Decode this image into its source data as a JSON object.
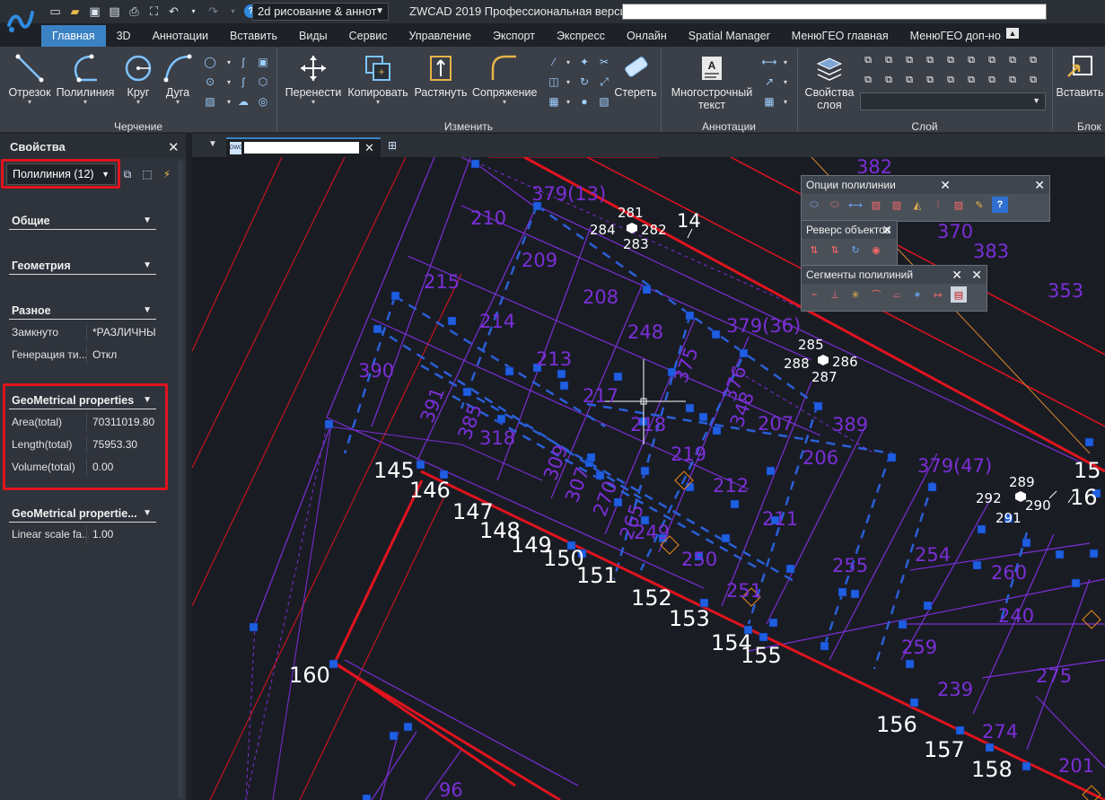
{
  "titlebar": {
    "workspace": "2d рисование & аннот",
    "app_title": "ZWCAD 2019 Профессиональная версия -",
    "qat_icons": [
      "new-icon",
      "open-icon",
      "save-icon",
      "save-as-icon",
      "print-icon",
      "plot-preview-icon",
      "undo-icon",
      "redo-icon",
      "help-icon"
    ]
  },
  "ribbon_tabs": [
    "Главная",
    "3D",
    "Аннотации",
    "Вставить",
    "Виды",
    "Сервис",
    "Управление",
    "Экспорт",
    "Экспресс",
    "Онлайн",
    "Spatial Manager",
    "МенюГЕО главная",
    "МенюГЕО доп-но"
  ],
  "ribbon": {
    "draw": {
      "label": "Черчение",
      "buttons": [
        "Отрезок",
        "Полилиния",
        "Круг",
        "Дуга"
      ]
    },
    "modify": {
      "label": "Изменить",
      "buttons": [
        "Перенести",
        "Копировать",
        "Растянуть",
        "Сопряжение",
        "Стереть"
      ]
    },
    "annotation": {
      "label": "Аннотации",
      "button_line1": "Многострочный",
      "button_line2": "текст"
    },
    "layer": {
      "label": "Слой",
      "button_line1": "Свойства",
      "button_line2": "слоя"
    },
    "block": {
      "label": "Блок",
      "button": "Вставить"
    }
  },
  "properties": {
    "title": "Свойства",
    "object_select": "Полилиния (12)",
    "sections": {
      "general": "Общие",
      "geometry": "Геометрия",
      "misc": "Разное",
      "geom_props": "GeoMetrical properties",
      "geom_props2": "GeoMetrical propertie..."
    },
    "misc_rows": [
      {
        "key": "Замкнуто",
        "value": "*РАЗЛИЧНЫ"
      },
      {
        "key": "Генерация ти...",
        "value": "Откл"
      }
    ],
    "geom_rows": [
      {
        "key": "Area(total)",
        "value": "70311019.80"
      },
      {
        "key": "Length(total)",
        "value": "75953.30"
      },
      {
        "key": "Volume(total)",
        "value": "0.00"
      }
    ],
    "geom2_rows": [
      {
        "key": "Linear scale fa...",
        "value": "1.00"
      }
    ]
  },
  "toolbars": {
    "polyline_options": "Опции полилинии",
    "reverse_objects": "Реверс объектов",
    "polyline_segments": "Сегменты полилиний"
  },
  "drawing": {
    "parcels": [
      "379(13)",
      "210",
      "209",
      "215",
      "208",
      "214",
      "248",
      "213",
      "379(36)",
      "390",
      "375",
      "376",
      "391",
      "385",
      "217",
      "348",
      "207",
      "389",
      "218",
      "318",
      "219",
      "206",
      "379(47)",
      "309",
      "307",
      "270",
      "212",
      "265",
      "211",
      "249",
      "254",
      "250",
      "255",
      "260",
      "251",
      "240",
      "259",
      "239",
      "275",
      "274",
      "201",
      "96",
      "370",
      "383",
      "353",
      "382"
    ],
    "points": [
      "281",
      "284",
      "282",
      "283",
      "14",
      "285",
      "288",
      "286",
      "287",
      "289",
      "292",
      "290",
      "291",
      "15",
      "16",
      "145",
      "146",
      "147",
      "148",
      "149",
      "150",
      "151",
      "152",
      "153",
      "154",
      "155",
      "156",
      "157",
      "158",
      "160"
    ]
  },
  "colors": {
    "accent": "#3b82c4",
    "highlight_box": "#e0141e",
    "parcel_line": "#8a3cff",
    "boundary_red": "#e01a1a",
    "grip": "#1f5ee0"
  }
}
